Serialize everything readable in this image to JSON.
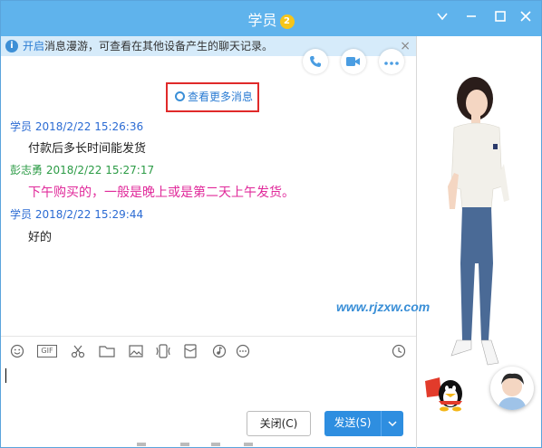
{
  "window": {
    "title": "学员",
    "badge": "2"
  },
  "notice": {
    "link": "开启",
    "text": "消息漫游，可查看在其他设备产生的聊天记录。"
  },
  "chat": {
    "more_messages": "查看更多消息",
    "messages": [
      {
        "sender": "学员",
        "time": "2018/2/22 15:26:36",
        "text": "付款后多长时间能发货"
      },
      {
        "sender": "彭志勇",
        "time": "2018/2/22 15:27:17",
        "text": "下午购买的，一般是晚上或是第二天上午发货。"
      },
      {
        "sender": "学员",
        "time": "2018/2/22 15:29:44",
        "text": "好的"
      }
    ]
  },
  "toolbar": {
    "gif_label": "GIF"
  },
  "buttons": {
    "close": "关闭(C)",
    "send": "发送(S)"
  },
  "watermark": "www.rjzxw.com",
  "colors": {
    "titlebar": "#5fb3ec",
    "accent": "#2e8ee0",
    "highlight_box": "#e02a2a",
    "self_name": "#2b6bd3",
    "other_name": "#2b9b45",
    "pink_msg": "#e0299a"
  }
}
